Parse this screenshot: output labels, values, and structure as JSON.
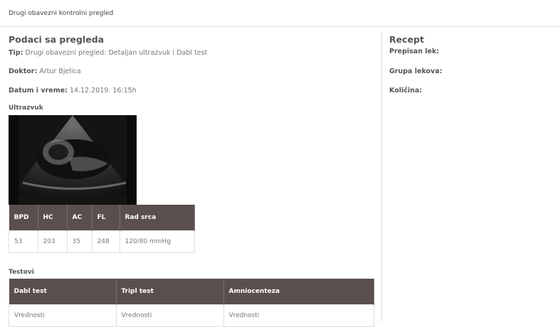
{
  "header": {
    "title": "Drugi obavezni kontrolni pregled"
  },
  "exam": {
    "heading": "Podaci sa pregleda",
    "type_label": "Tip:",
    "type_value": "Drugi obavezni pregled: Detaljan ultrazvuk i Dabl test",
    "doctor_label": "Doktor:",
    "doctor_value": "Artur Bjelica",
    "datetime_label": "Datum i vreme:",
    "datetime_value": "14.12.2019. 16:15h",
    "ultrasound_label": "Ultrazvuk",
    "ultrasound_table": {
      "headers": [
        "BPD",
        "HC",
        "AC",
        "FL",
        "Rad srca"
      ],
      "values": [
        "53",
        "203",
        "35",
        "248",
        "120/80 mmHg"
      ]
    },
    "tests_label": "Testovi",
    "tests_table": {
      "headers": [
        "Dabl test",
        "Tripl test",
        "Amniocenteza"
      ],
      "values": [
        "Vrednosti",
        "Vrednosti",
        "Vrednosti"
      ]
    }
  },
  "prescription": {
    "heading": "Recept",
    "drug_label": "Prepisan lek:",
    "group_label": "Grupa lekova:",
    "quantity_label": "Količina:"
  }
}
